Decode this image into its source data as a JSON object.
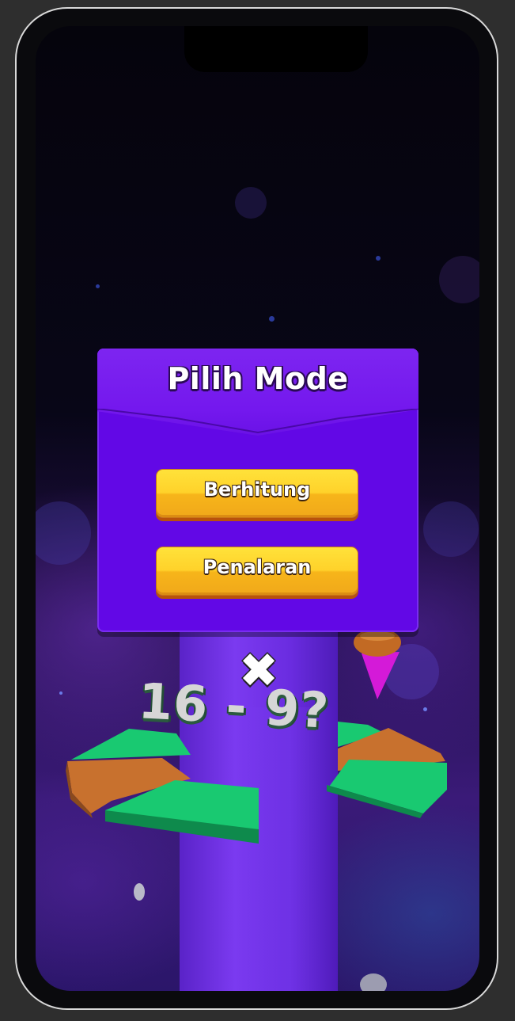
{
  "modal": {
    "title": "Pilih Mode",
    "buttons": [
      {
        "label": "Berhitung"
      },
      {
        "label": "Penalaran"
      }
    ]
  },
  "game": {
    "question": "16 - 9?",
    "wrong_mark": "✖"
  },
  "colors": {
    "modal_bg": "#6208e6",
    "button_yellow": "#ffd22a",
    "platform_green": "#19c971",
    "platform_orange": "#c8712e",
    "tower_purple": "#6a2ce0"
  }
}
